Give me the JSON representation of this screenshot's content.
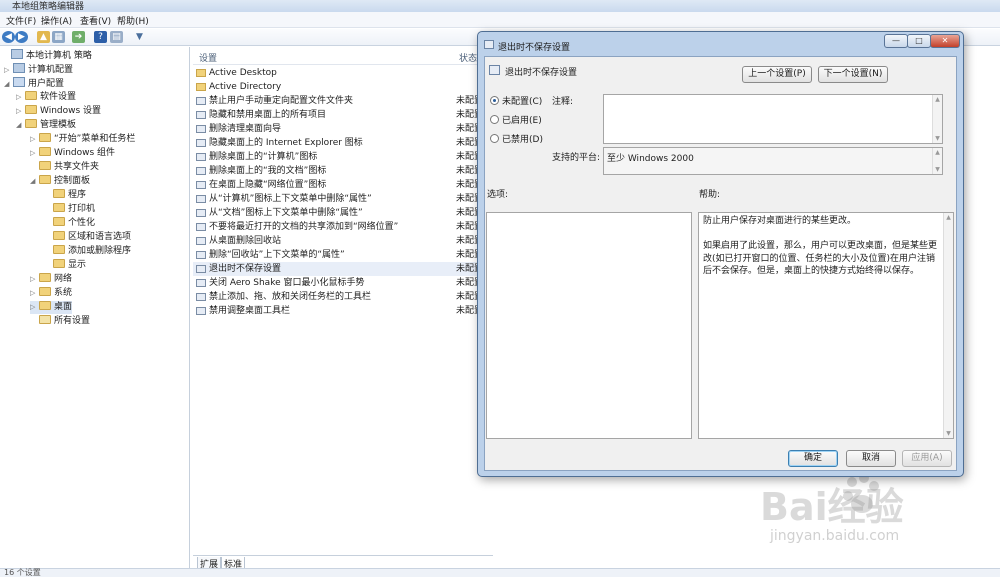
{
  "window": {
    "title": "本地组策略编辑器"
  },
  "menu": [
    {
      "label": "文件(F)"
    },
    {
      "label": "操作(A)"
    },
    {
      "label": "查看(V)"
    },
    {
      "label": "帮助(H)"
    }
  ],
  "toolbar_icons": [
    "back-icon",
    "forward-icon",
    "up-folder-icon",
    "show-hide-tree-icon",
    "export-list-icon",
    "help-icon",
    "properties-icon",
    "filter-icon"
  ],
  "tree": [
    {
      "label": "本地计算机 策略",
      "icon": "computer-policy-icon",
      "expander": ""
    },
    {
      "label": "计算机配置",
      "icon": "computer-icon",
      "expander": "▷"
    },
    {
      "label": "用户配置",
      "icon": "user-icon",
      "expander": "◢"
    },
    {
      "label": "软件设置",
      "icon": "folder-icon",
      "expander": "▷"
    },
    {
      "label": "Windows 设置",
      "icon": "folder-icon",
      "expander": "▷"
    },
    {
      "label": "管理模板",
      "icon": "folder-icon",
      "expander": "◢"
    },
    {
      "label": "“开始”菜单和任务栏",
      "icon": "folder-icon",
      "expander": "▷"
    },
    {
      "label": "Windows 组件",
      "icon": "folder-icon",
      "expander": "▷"
    },
    {
      "label": "共享文件夹",
      "icon": "folder-icon",
      "expander": ""
    },
    {
      "label": "控制面板",
      "icon": "folder-icon",
      "expander": "◢"
    },
    {
      "label": "程序",
      "icon": "folder-icon",
      "expander": ""
    },
    {
      "label": "打印机",
      "icon": "folder-icon",
      "expander": ""
    },
    {
      "label": "个性化",
      "icon": "folder-icon",
      "expander": ""
    },
    {
      "label": "区域和语言选项",
      "icon": "folder-icon",
      "expander": ""
    },
    {
      "label": "添加或删除程序",
      "icon": "folder-icon",
      "expander": ""
    },
    {
      "label": "显示",
      "icon": "folder-icon",
      "expander": ""
    },
    {
      "label": "网络",
      "icon": "folder-icon",
      "expander": "▷"
    },
    {
      "label": "系统",
      "icon": "folder-icon",
      "expander": "▷"
    },
    {
      "label": "桌面",
      "icon": "folder-icon",
      "expander": "▷"
    },
    {
      "label": "所有设置",
      "icon": "all-settings-icon",
      "expander": ""
    }
  ],
  "list": {
    "col_setting": "设置",
    "col_state": "状态",
    "rows": [
      {
        "name": "Active Desktop",
        "state": "",
        "type": "folder"
      },
      {
        "name": "Active Directory",
        "state": "",
        "type": "folder"
      },
      {
        "name": "禁止用户手动重定向配置文件文件夹",
        "state": "未配置",
        "type": "setting"
      },
      {
        "name": "隐藏和禁用桌面上的所有项目",
        "state": "未配置",
        "type": "setting"
      },
      {
        "name": "删除清理桌面向导",
        "state": "未配置",
        "type": "setting"
      },
      {
        "name": "隐藏桌面上的 Internet Explorer 图标",
        "state": "未配置",
        "type": "setting"
      },
      {
        "name": "删除桌面上的“计算机”图标",
        "state": "未配置",
        "type": "setting"
      },
      {
        "name": "删除桌面上的“我的文档”图标",
        "state": "未配置",
        "type": "setting"
      },
      {
        "name": "在桌面上隐藏“网络位置”图标",
        "state": "未配置",
        "type": "setting"
      },
      {
        "name": "从“计算机”图标上下文菜单中删除“属性”",
        "state": "未配置",
        "type": "setting"
      },
      {
        "name": "从“文档”图标上下文菜单中删除“属性”",
        "state": "未配置",
        "type": "setting"
      },
      {
        "name": "不要将最近打开的文档的共享添加到“网络位置”",
        "state": "未配置",
        "type": "setting"
      },
      {
        "name": "从桌面删除回收站",
        "state": "未配置",
        "type": "setting"
      },
      {
        "name": "删除“回收站”上下文菜单的“属性”",
        "state": "未配置",
        "type": "setting"
      },
      {
        "name": "退出时不保存设置",
        "state": "未配置",
        "type": "setting",
        "selected": true
      },
      {
        "name": "关闭 Aero Shake 窗口最小化鼠标手势",
        "state": "未配置",
        "type": "setting"
      },
      {
        "name": "禁止添加、拖、放和关闭任务栏的工具栏",
        "state": "未配置",
        "type": "setting"
      },
      {
        "name": "禁用调整桌面工具栏",
        "state": "未配置",
        "type": "setting"
      }
    ]
  },
  "tabs": [
    {
      "label": "扩展"
    },
    {
      "label": "标准"
    }
  ],
  "status": {
    "text": "16 个设置"
  },
  "dialog": {
    "title": "退出时不保存设置",
    "heading": "退出时不保存设置",
    "prev_label": "上一个设置(P)",
    "next_label": "下一个设置(N)",
    "radio_not_configured": "未配置(C)",
    "radio_enabled": "已启用(E)",
    "radio_disabled": "已禁用(D)",
    "selected_option": "未配置(C)",
    "comment_label": "注释:",
    "comment_value": "",
    "platform_label": "支持的平台:",
    "platform_value": "至少 Windows 2000",
    "options_label": "选项:",
    "help_label": "帮助:",
    "help_text": "防止用户保存对桌面进行的某些更改。\n\n如果启用了此设置，那么，用户可以更改桌面，但是某些更改(如已打开窗口的位置、任务栏的大小及位置)在用户注销后不会保存。但是，桌面上的快捷方式始终得以保存。",
    "ok_label": "确定",
    "cancel_label": "取消",
    "apply_label": "应用(A)"
  },
  "watermark": {
    "brand": "Bai经验",
    "url": "jingyan.baidu.com"
  }
}
